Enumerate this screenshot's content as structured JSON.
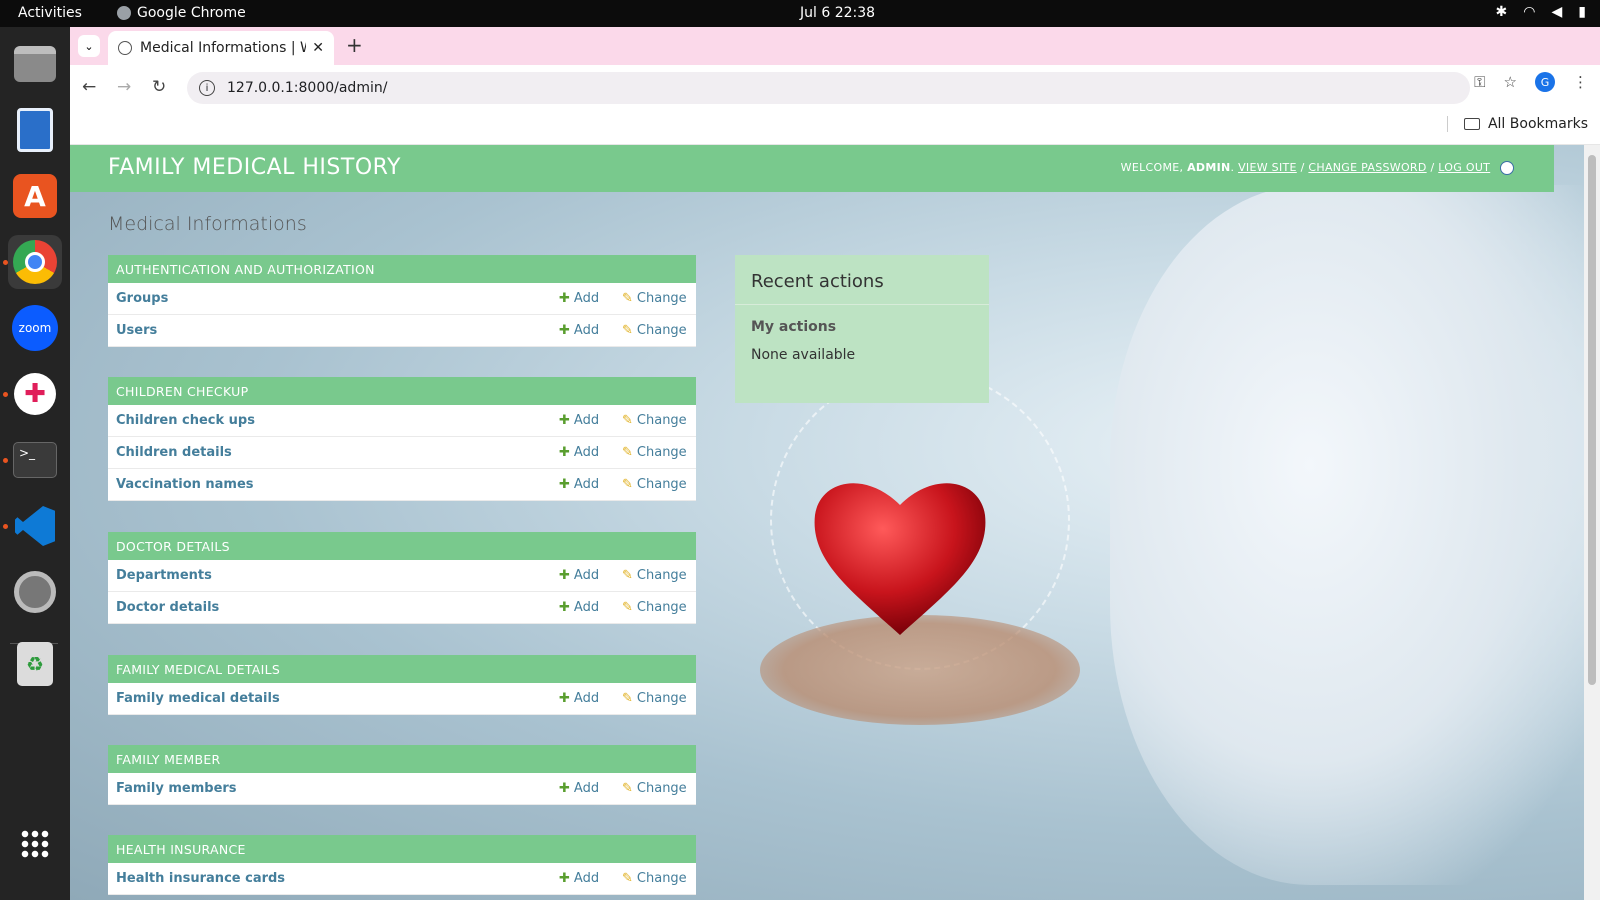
{
  "system": {
    "activities": "Activities",
    "app_name": "Google Chrome",
    "clock": "Jul 6  22:38"
  },
  "dock": {
    "items": [
      "files-icon",
      "writer-icon",
      "app-center-icon",
      "chrome-icon",
      "zoom-icon",
      "slack-icon",
      "terminal-icon",
      "vscode-icon",
      "settings-icon",
      "trash-icon",
      "apps-grid-icon"
    ],
    "zoom_label": "zoom"
  },
  "browser": {
    "tab_title": "Medical Informations | W",
    "url": "127.0.0.1:8000/admin/",
    "profile_initial": "G",
    "bookmarks_label": "All Bookmarks"
  },
  "admin": {
    "branding": "FAMILY MEDICAL HISTORY",
    "welcome": "WELCOME,",
    "user": "ADMIN",
    "view_site": "VIEW SITE",
    "change_password": "CHANGE PASSWORD",
    "log_out": "LOG OUT",
    "sep": "/",
    "page_title": "Medical Informations",
    "add_label": "Add",
    "change_label": "Change",
    "modules": [
      {
        "caption": "AUTHENTICATION AND AUTHORIZATION",
        "rows": [
          "Groups",
          "Users"
        ]
      },
      {
        "caption": "CHILDREN CHECKUP",
        "rows": [
          "Children check ups",
          "Children details",
          "Vaccination names"
        ]
      },
      {
        "caption": "DOCTOR DETAILS",
        "rows": [
          "Departments",
          "Doctor details"
        ]
      },
      {
        "caption": "FAMILY MEDICAL DETAILS",
        "rows": [
          "Family medical details"
        ]
      },
      {
        "caption": "FAMILY MEMBER",
        "rows": [
          "Family members"
        ]
      },
      {
        "caption": "HEALTH INSURANCE",
        "rows": [
          "Health insurance cards"
        ]
      }
    ],
    "recent": {
      "title": "Recent actions",
      "my_actions": "My actions",
      "none": "None available"
    }
  }
}
